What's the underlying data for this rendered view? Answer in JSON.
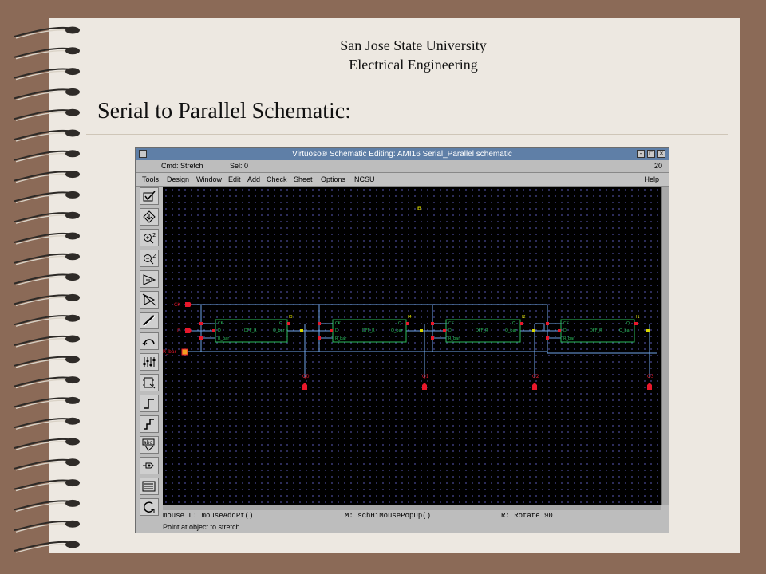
{
  "header": {
    "line1": "San Jose State University",
    "line2": "Electrical Engineering",
    "title": "Serial to Parallel Schematic:"
  },
  "window": {
    "title": "Virtuoso® Schematic Editing: AMI16 Serial_Parallel schematic",
    "controls": {
      "minimize": "-",
      "maximize": "□",
      "close": "×"
    }
  },
  "status": {
    "cmd": "Cmd: Stretch",
    "sel": "Sel: 0",
    "count": "20"
  },
  "menu": {
    "items": [
      "Tools",
      "Design",
      "Window",
      "Edit",
      "Add",
      "Check",
      "Sheet",
      "Options",
      "NCSU"
    ],
    "help": "Help"
  },
  "toolbar": {
    "icons": [
      "check-save-icon",
      "save-icon",
      "zoom-in-icon",
      "zoom-out-icon",
      "stretch-icon",
      "copy-icon",
      "wire-icon",
      "delete-icon",
      "undo-icon",
      "property-icon",
      "instance-icon",
      "pin-icon",
      "wire-narrow-icon",
      "wire-wide-icon",
      "label-icon",
      "pin-add-icon",
      "cmd-options-icon",
      "redraw-icon"
    ]
  },
  "schematic": {
    "inputs": [
      "CK",
      "D",
      "R_bar"
    ],
    "flipflops": [
      {
        "name": "DFF_R",
        "inst": "I3",
        "ports_left": [
          "CK",
          "D",
          "R_bar"
        ],
        "ports_right": [
          "Q",
          "Q_bar"
        ]
      },
      {
        "name": "DFF_R",
        "inst": "I4",
        "ports_left": [
          "CK",
          "D",
          "R_bar"
        ],
        "ports_right": [
          "Q",
          "Q_bar"
        ]
      },
      {
        "name": "DFF_R",
        "inst": "I2",
        "ports_left": [
          "CK",
          "D",
          "R_bar"
        ],
        "ports_right": [
          "Q",
          "Q_bar"
        ]
      },
      {
        "name": "DFF_R",
        "inst": "I1",
        "ports_left": [
          "CK",
          "D",
          "R_bar"
        ],
        "ports_right": [
          "Q",
          "Q_bar"
        ]
      }
    ],
    "outputs": [
      "Q0",
      "Q1",
      "Q2",
      "Q3"
    ]
  },
  "prompt": {
    "mouse_l": "mouse L: mouseAddPt()",
    "mouse_m": "M: schHiMousePopUp()",
    "mouse_r": "R: Rotate 90",
    "message": "Point at object to stretch"
  },
  "colors": {
    "canvas": "#000000",
    "wire": "#6fa5e8",
    "pin": "#e8182b",
    "symbol": "#2bbd5d",
    "titlebar": "#5f7fa7"
  }
}
